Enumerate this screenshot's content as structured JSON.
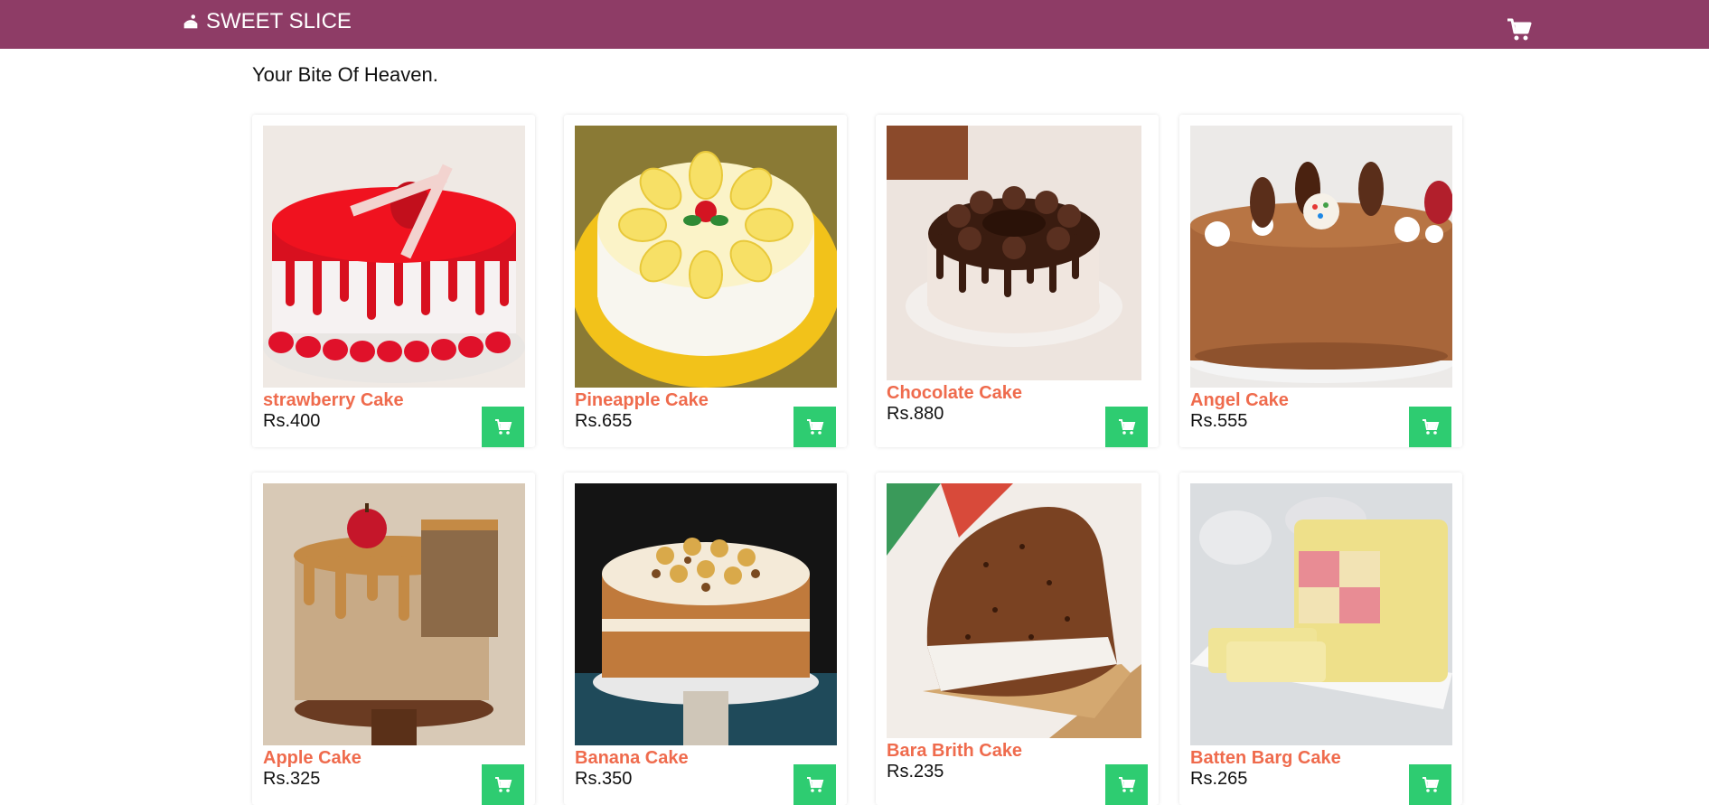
{
  "header": {
    "brand": "SWEET SLICE",
    "brand_icon": "cake-icon",
    "cart_icon": "cart-icon",
    "bg_color": "#8e3c66"
  },
  "tagline": "Your Bite Of Heaven.",
  "accent": {
    "name_color": "#ef6b4d",
    "add_button_color": "#2ecc71"
  },
  "products": [
    {
      "name": "strawberry Cake",
      "price": "Rs.400"
    },
    {
      "name": "Pineapple Cake",
      "price": "Rs.655"
    },
    {
      "name": "Chocolate Cake",
      "price": "Rs.880"
    },
    {
      "name": "Angel Cake",
      "price": "Rs.555"
    },
    {
      "name": "Apple Cake",
      "price": "Rs.325"
    },
    {
      "name": "Banana Cake",
      "price": "Rs.350"
    },
    {
      "name": "Bara Brith Cake",
      "price": "Rs.235"
    },
    {
      "name": "Batten Barg Cake",
      "price": "Rs.265"
    }
  ]
}
